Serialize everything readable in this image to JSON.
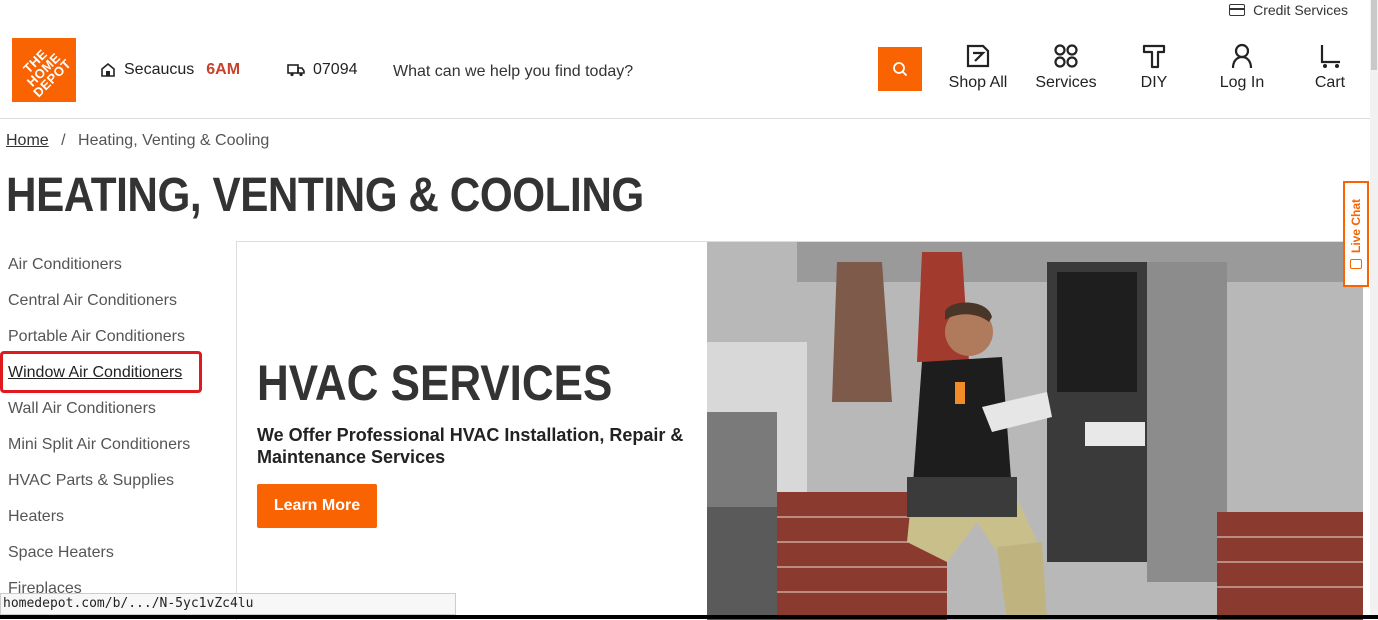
{
  "utility": {
    "credit_label": "Credit Services"
  },
  "header": {
    "logo_text": "THE HOME DEPOT",
    "store_name": "Secaucus",
    "store_hours": "6AM",
    "zip": "07094",
    "search_placeholder": "What can we help you find today?",
    "nav": [
      {
        "label": "Shop All",
        "icon": "shop-all-icon"
      },
      {
        "label": "Services",
        "icon": "services-icon"
      },
      {
        "label": "DIY",
        "icon": "diy-hammer-icon"
      },
      {
        "label": "Log In",
        "icon": "user-icon"
      },
      {
        "label": "Cart",
        "icon": "cart-icon"
      }
    ]
  },
  "breadcrumb": {
    "home": "Home",
    "separator": "/",
    "current": "Heating, Venting & Cooling"
  },
  "page_title": "HEATING, VENTING & COOLING",
  "sidebar": {
    "items": [
      "Air Conditioners",
      "Central Air Conditioners",
      "Portable Air Conditioners",
      "Window Air Conditioners",
      "Wall Air Conditioners",
      "Mini Split Air Conditioners",
      "HVAC Parts & Supplies",
      "Heaters",
      "Space Heaters",
      "Fireplaces"
    ],
    "highlighted": "Window Air Conditioners"
  },
  "hero": {
    "title": "HVAC SERVICES",
    "subtitle": "We Offer Professional HVAC Installation, Repair & Maintenance Services",
    "button": "Learn More"
  },
  "live_chat": {
    "label": "Live Chat"
  },
  "status_url": "homedepot.com/b/.../N-5yc1vZc4lu",
  "colors": {
    "brand_orange": "#f96302",
    "highlight_red": "#e0191e",
    "text_dark": "#333333"
  }
}
